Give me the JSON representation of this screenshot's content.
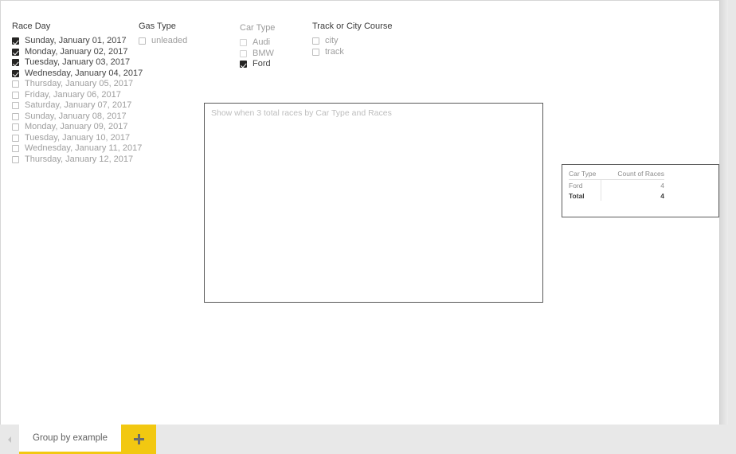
{
  "canvas": {
    "slicers": [
      {
        "id": "raceday",
        "title": "Race Day",
        "dim": false,
        "items": [
          {
            "label": "Sunday, January 01, 2017",
            "checked": true
          },
          {
            "label": "Monday, January 02, 2017",
            "checked": true
          },
          {
            "label": "Tuesday, January 03, 2017",
            "checked": true
          },
          {
            "label": "Wednesday, January 04, 2017",
            "checked": true
          },
          {
            "label": "Thursday, January 05, 2017",
            "checked": false
          },
          {
            "label": "Friday, January 06, 2017",
            "checked": false
          },
          {
            "label": "Saturday, January 07, 2017",
            "checked": false
          },
          {
            "label": "Sunday, January 08, 2017",
            "checked": false
          },
          {
            "label": "Monday, January 09, 2017",
            "checked": false
          },
          {
            "label": "Tuesday, January 10, 2017",
            "checked": false
          },
          {
            "label": "Wednesday, January 11, 2017",
            "checked": false
          },
          {
            "label": "Thursday, January 12, 2017",
            "checked": false
          }
        ]
      },
      {
        "id": "gastype",
        "title": "Gas Type",
        "dim": false,
        "items": [
          {
            "label": "unleaded",
            "checked": false
          }
        ]
      },
      {
        "id": "cartype",
        "title": "Car Type",
        "dim": true,
        "items": [
          {
            "label": "Audi",
            "checked": false
          },
          {
            "label": "BMW",
            "checked": false
          },
          {
            "label": "Ford",
            "checked": true
          }
        ]
      },
      {
        "id": "track",
        "title": "Track or City Course",
        "dim": false,
        "items": [
          {
            "label": "city",
            "checked": false
          },
          {
            "label": "track",
            "checked": false
          }
        ]
      }
    ],
    "textbox": {
      "placeholder": "Show when 3 total races by Car Type and Races"
    },
    "table": {
      "columns": [
        "Car Type",
        "Count of Races"
      ],
      "rows": [
        {
          "cells": [
            "Ford",
            "4"
          ],
          "total": false
        },
        {
          "cells": [
            "Total",
            "4"
          ],
          "total": true
        }
      ]
    }
  },
  "tabbar": {
    "scroll_left_icon": "chevron-left-icon",
    "tabs": [
      {
        "label": "Group by example",
        "active": true
      }
    ],
    "add_label": "+",
    "add_icon": "plus-icon"
  },
  "colors": {
    "accent": "#f2c811",
    "canvas_bg": "#ffffff",
    "shell_bg": "#e8e8e8",
    "checkbox_checked": "#252423"
  }
}
